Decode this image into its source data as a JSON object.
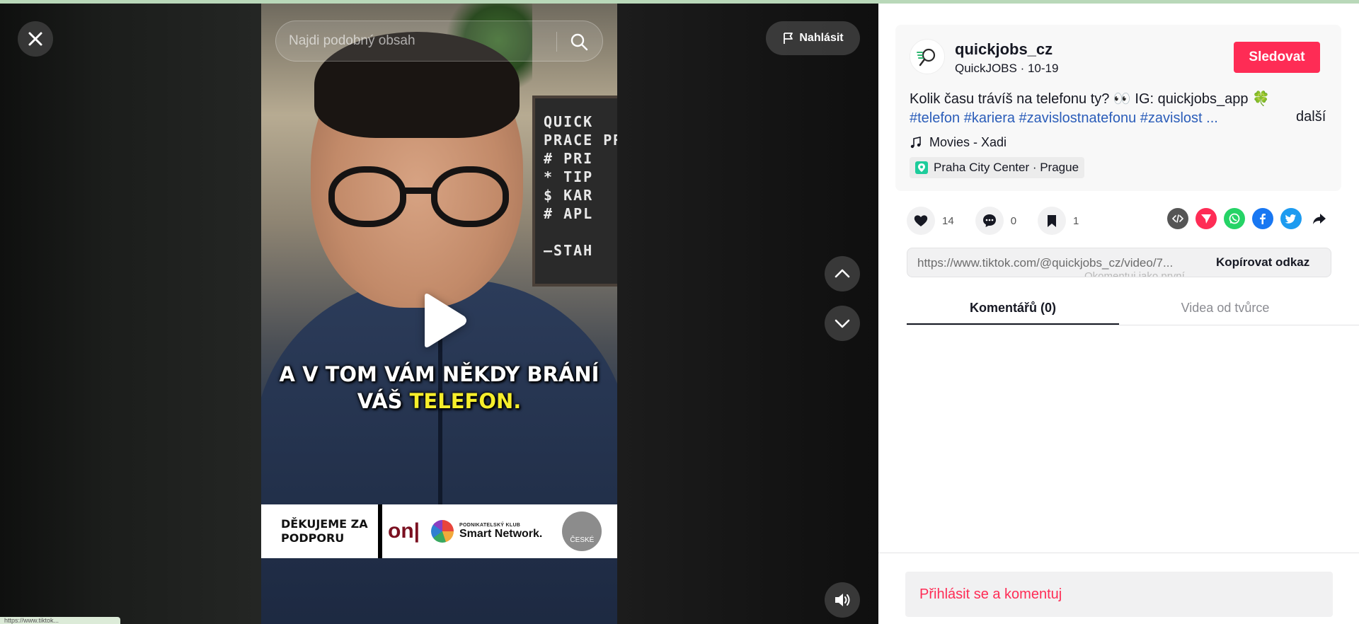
{
  "search": {
    "placeholder": "Najdi podobný obsah"
  },
  "report": {
    "label": "Nahlásit"
  },
  "video": {
    "board_text": "QUICK\nPRACE PRO\n# PRI\n* TIP\n$ KAR\n# APL\n\n—STAH",
    "subtitle_line1": "A V TOM VÁM NĚKDY BRÁNÍ",
    "subtitle_line2_prefix": "VÁŠ ",
    "subtitle_line2_highlight": "TELEFON.",
    "sponsor_thanks": "DĚKUJEME ZA PODPORU",
    "sponsor_partial": "on|",
    "sponsor_club_small": "PODNIKATELSKÝ KLUB",
    "sponsor_club_name": "Smart Network.",
    "sponsor_ceske": "ČESKÉ"
  },
  "status_url": "https://www.tiktok...",
  "author": {
    "username": "quickjobs_cz",
    "subline": "QuickJOBS · 10-19",
    "follow_label": "Sledovat"
  },
  "description": {
    "text": "Kolik času trávíš na telefonu ty? 👀 IG: quickjobs_app 🍀",
    "tags": "#telefon #kariera #zavislostnatefonu #zavislost ...",
    "more_label": "další"
  },
  "music": {
    "label": "Movies - Xadi"
  },
  "location": {
    "label": "Praha City Center · Prague"
  },
  "stats": {
    "likes": "14",
    "comments": "0",
    "saves": "1"
  },
  "copy": {
    "url": "https://www.tiktok.com/@quickjobs_cz/video/7...",
    "button_label": "Kopírovat odkaz",
    "ghost_text": "Okomentuj jako první"
  },
  "tabs": [
    {
      "label": "Komentářů (0)"
    },
    {
      "label": "Videa od tvůrce"
    }
  ],
  "login_prompt": "Přihlásit se a komentuj",
  "colors": {
    "accent": "#fe2c55",
    "hashtag": "#2b5db9",
    "subtitle_highlight": "#f6ee2b",
    "whatsapp": "#25d366",
    "facebook": "#1877f2",
    "twitter": "#1d9bf0",
    "embed": "#555555"
  },
  "icons": [
    "close-icon",
    "search-icon",
    "flag-icon",
    "play-icon",
    "chevron-up-icon",
    "chevron-down-icon",
    "volume-icon",
    "music-note-icon",
    "location-pin-icon",
    "heart-icon",
    "comment-icon",
    "bookmark-icon",
    "embed-icon",
    "send-icon",
    "whatsapp-icon",
    "facebook-icon",
    "twitter-icon",
    "share-arrow-icon"
  ]
}
